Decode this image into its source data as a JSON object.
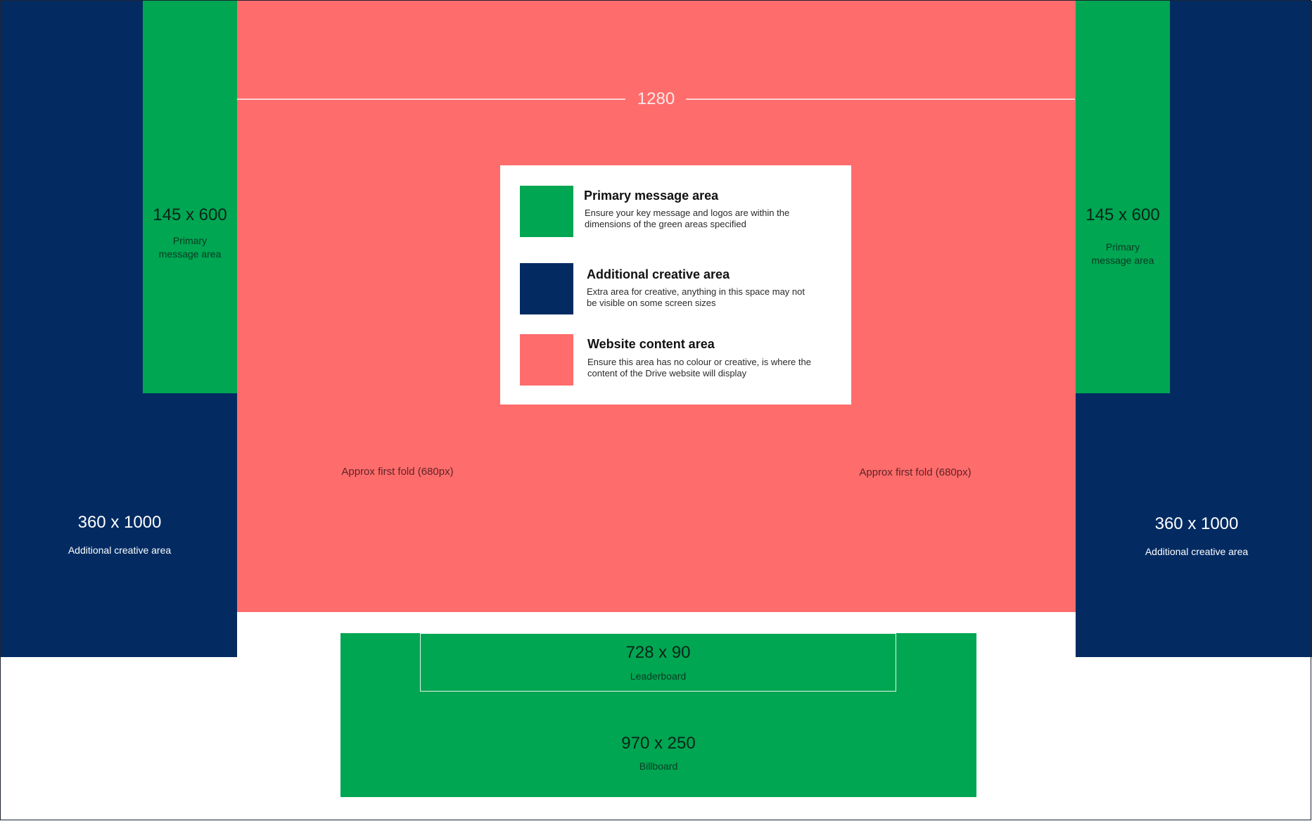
{
  "colors": {
    "primary_message": "#00A651",
    "additional_creative": "#032B62",
    "website_content": "#FF6C6C",
    "background": "#FFFFFF"
  },
  "content_width_label": "1280",
  "left_primary": {
    "size": "145 x 600",
    "label": "Primary message area"
  },
  "right_primary": {
    "size": "145 x 600",
    "label": "Primary message area"
  },
  "left_additional": {
    "size": "360 x  1000",
    "label": "Additional creative area"
  },
  "right_additional": {
    "size": "360 x  1000",
    "label": "Additional creative area"
  },
  "fold_note_left": "Approx first fold (680px)",
  "fold_note_right": "Approx first fold (680px)",
  "leaderboard": {
    "size": "728 x 90",
    "label": "Leaderboard"
  },
  "billboard": {
    "size": "970 x 250",
    "label": "Billboard"
  },
  "legend": {
    "items": [
      {
        "title": "Primary message area",
        "description": "Ensure your key message and logos are within the dimensions of the green areas specified"
      },
      {
        "title": "Additional creative area",
        "description": "Extra area for creative, anything in this space may not be visible on some screen sizes"
      },
      {
        "title": "Website content area",
        "description": "Ensure this area has no colour or creative, is where the content of the Drive website will display"
      }
    ]
  }
}
